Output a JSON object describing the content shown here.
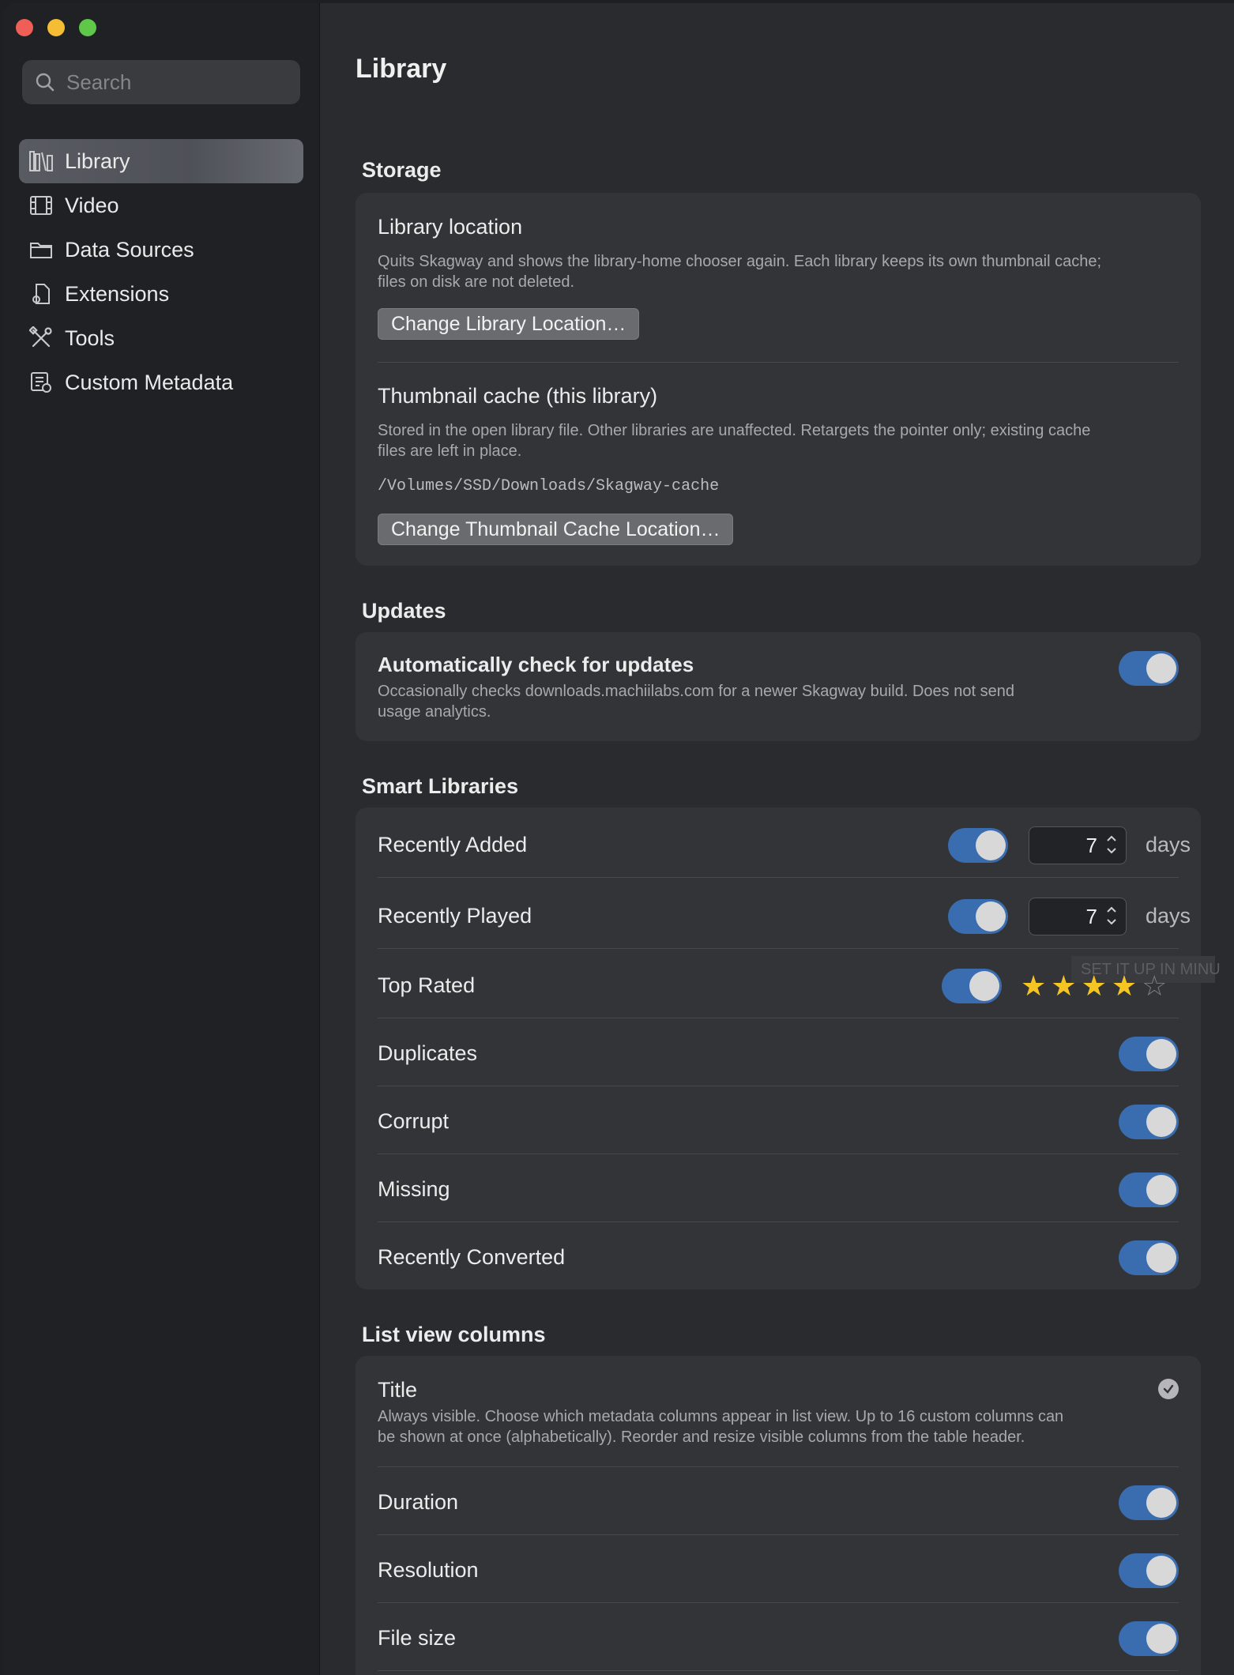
{
  "window": {
    "title": "Library"
  },
  "sidebar": {
    "search_placeholder": "Search",
    "items": [
      {
        "label": "Library",
        "icon": "library-icon",
        "active": true
      },
      {
        "label": "Video",
        "icon": "film-icon"
      },
      {
        "label": "Data Sources",
        "icon": "folder-icon"
      },
      {
        "label": "Extensions",
        "icon": "extension-icon"
      },
      {
        "label": "Tools",
        "icon": "tools-icon"
      },
      {
        "label": "Custom Metadata",
        "icon": "custom-metadata-icon"
      }
    ]
  },
  "page": {
    "title": "Library"
  },
  "storage": {
    "heading": "Storage",
    "library_location": {
      "title": "Library location",
      "desc_line1": "Quits Skagway and shows the library-home chooser again. Each library keeps its own thumbnail cache;",
      "desc_line2": "files on disk are not deleted.",
      "button": "Change Library Location…"
    },
    "thumbnail_cache": {
      "title": "Thumbnail cache (this library)",
      "desc_line1": "Stored in the open library file. Other libraries are unaffected. Retargets the pointer only; existing cache",
      "desc_line2": "files are left in place.",
      "path": "/Volumes/SSD/Downloads/Skagway-cache",
      "button": "Change Thumbnail Cache Location…"
    }
  },
  "updates": {
    "heading": "Updates",
    "auto_check": {
      "title": "Automatically check for updates",
      "desc_line1": "Occasionally checks downloads.machiilabs.com for a newer Skagway build. Does not send",
      "desc_line2": "usage analytics.",
      "enabled": true
    }
  },
  "smart_libraries": {
    "heading": "Smart Libraries",
    "recently_added": {
      "label": "Recently Added",
      "enabled": true,
      "value": "7",
      "unit": "days"
    },
    "recently_played": {
      "label": "Recently Played",
      "enabled": true,
      "value": "7",
      "unit": "days"
    },
    "top_rated": {
      "label": "Top Rated",
      "enabled": true,
      "rating": 4,
      "max_rating": 5,
      "tooltip": "SET IT UP IN MINU"
    },
    "duplicates": {
      "label": "Duplicates",
      "enabled": true
    },
    "corrupt": {
      "label": "Corrupt",
      "enabled": true
    },
    "missing": {
      "label": "Missing",
      "enabled": true
    },
    "recently_converted": {
      "label": "Recently Converted",
      "enabled": true
    }
  },
  "list_view_columns": {
    "heading": "List view columns",
    "title_column": {
      "label": "Title",
      "desc_line1": "Always visible. Choose which metadata columns appear in list view. Up to 16 custom columns can",
      "desc_line2": "be shown at once (alphabetically). Reorder and resize visible columns from the table header.",
      "checked": true
    },
    "duration": {
      "label": "Duration",
      "enabled": true
    },
    "resolution": {
      "label": "Resolution",
      "enabled": true
    },
    "file_size": {
      "label": "File size",
      "enabled": true
    }
  },
  "colors": {
    "accent_toggle": "#3a6db0",
    "star": "#f5c623",
    "sidebar_bg": "#202124",
    "main_bg": "#2a2b2e"
  }
}
